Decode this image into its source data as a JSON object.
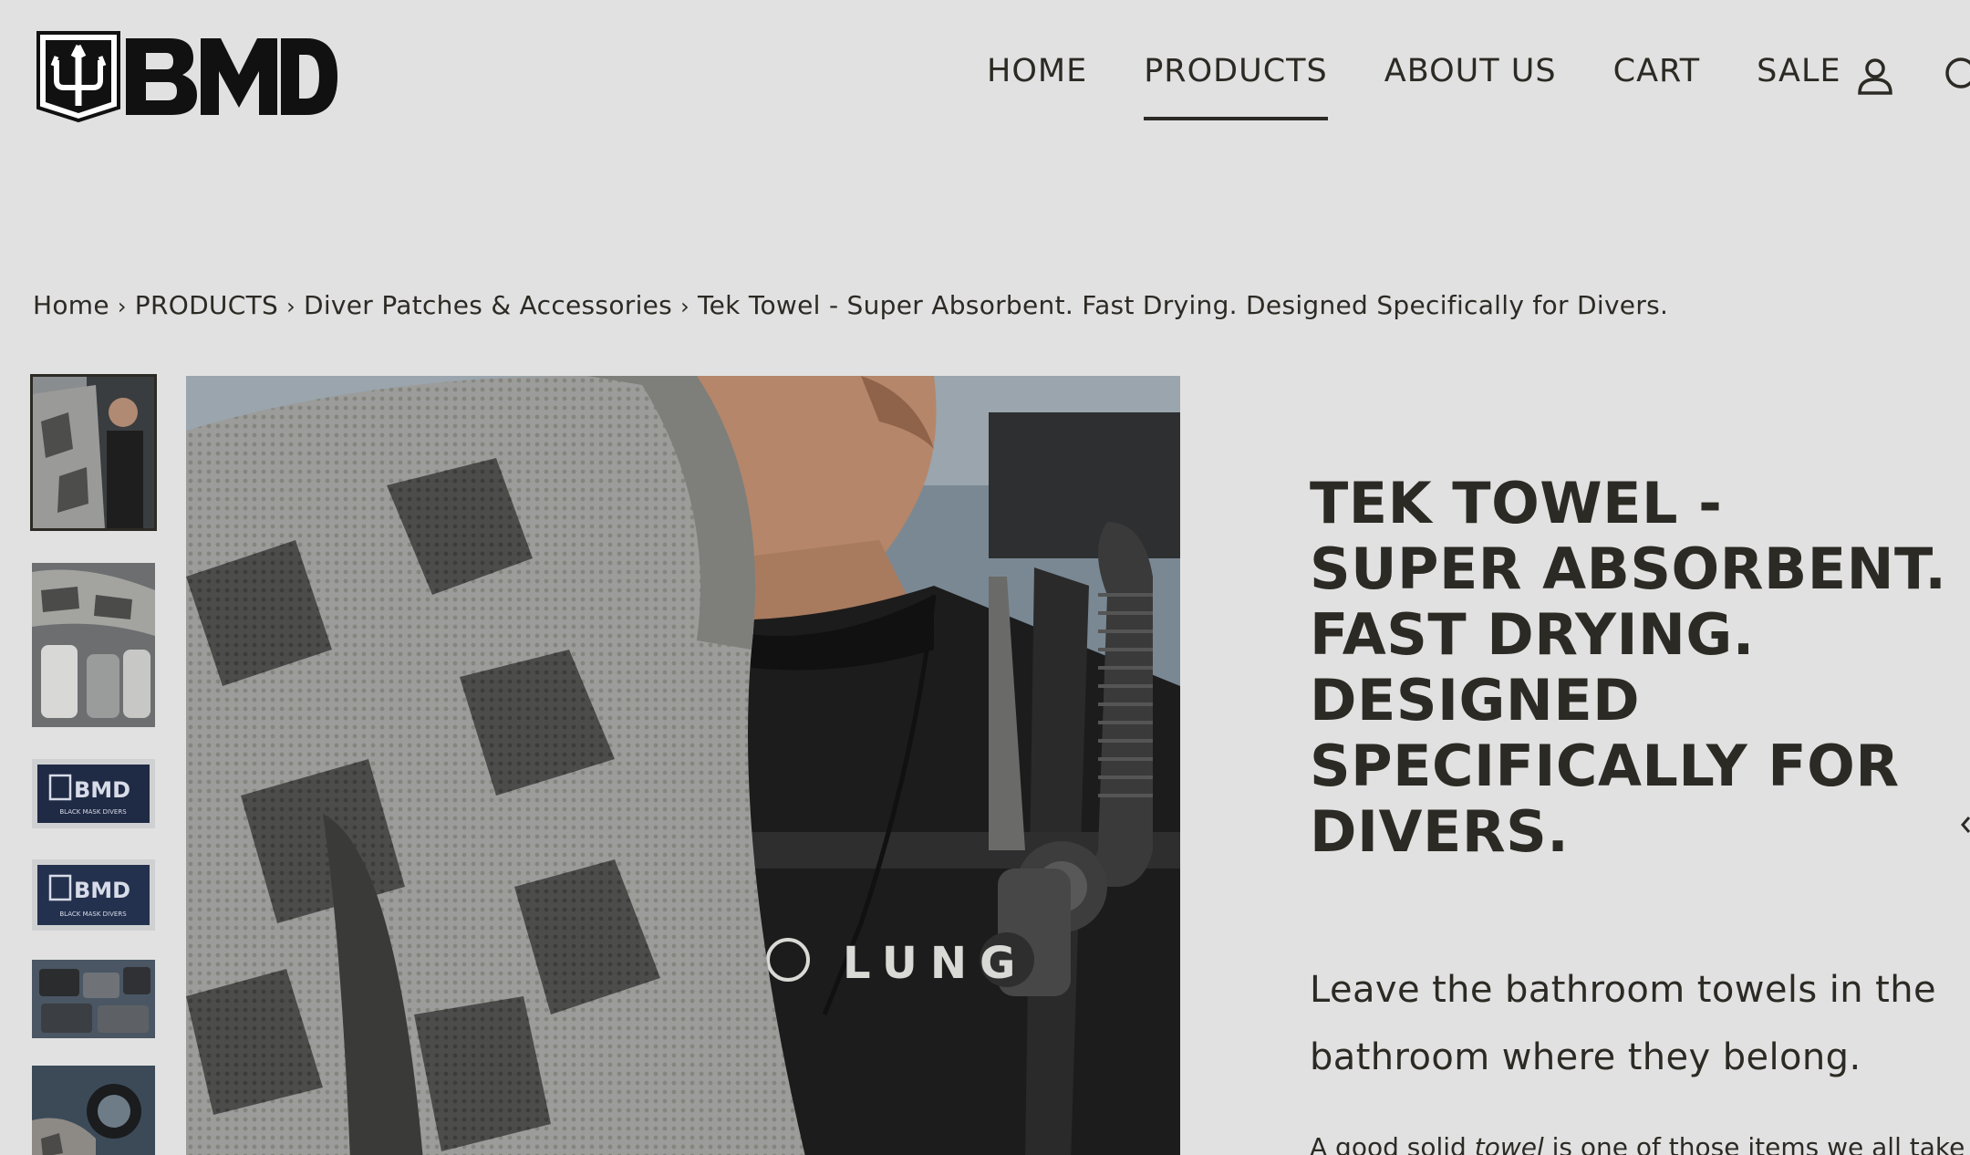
{
  "header": {
    "logo_text": "BMD",
    "nav": [
      {
        "label": "HOME",
        "active": false
      },
      {
        "label": "PRODUCTS",
        "active": true
      },
      {
        "label": "ABOUT US",
        "active": false
      },
      {
        "label": "CART",
        "active": false
      },
      {
        "label": "SALE",
        "active": false
      }
    ],
    "icons": [
      "account-icon",
      "search-icon"
    ]
  },
  "breadcrumb": {
    "items": [
      "Home",
      "PRODUCTS",
      "Diver Patches & Accessories",
      "Tek Towel - Super Absorbent. Fast Drying. Designed Specifically for Divers."
    ],
    "separator": "›"
  },
  "gallery": {
    "thumbnails": [
      {
        "alt": "towel-over-shoulder",
        "selected": true
      },
      {
        "alt": "towel-with-gear",
        "selected": false
      },
      {
        "alt": "black-mask-divers-towel-flat",
        "selected": false,
        "caption": "BLACK MASK DIVERS"
      },
      {
        "alt": "black-mask-divers-towel-flat-2",
        "selected": false,
        "caption": "BLACK MASK DIVERS"
      },
      {
        "alt": "towels-folded",
        "selected": false
      },
      {
        "alt": "diving-gear-with-towel",
        "selected": false
      }
    ],
    "main_image_text": "LUNG"
  },
  "product": {
    "title": "TEK TOWEL - SUPER ABSORBENT. FAST DRYING. DESIGNED SPECIFICALLY FOR DIVERS.",
    "lead": "Leave the bathroom towels in the bathroom where they belong.",
    "body_start": "A good solid ",
    "body_em": "towel",
    "body_end": " is one of those items we all take"
  },
  "colors": {
    "background": "#e1e1e1",
    "text": "#2c2a24",
    "accent": "#2c2a24"
  }
}
